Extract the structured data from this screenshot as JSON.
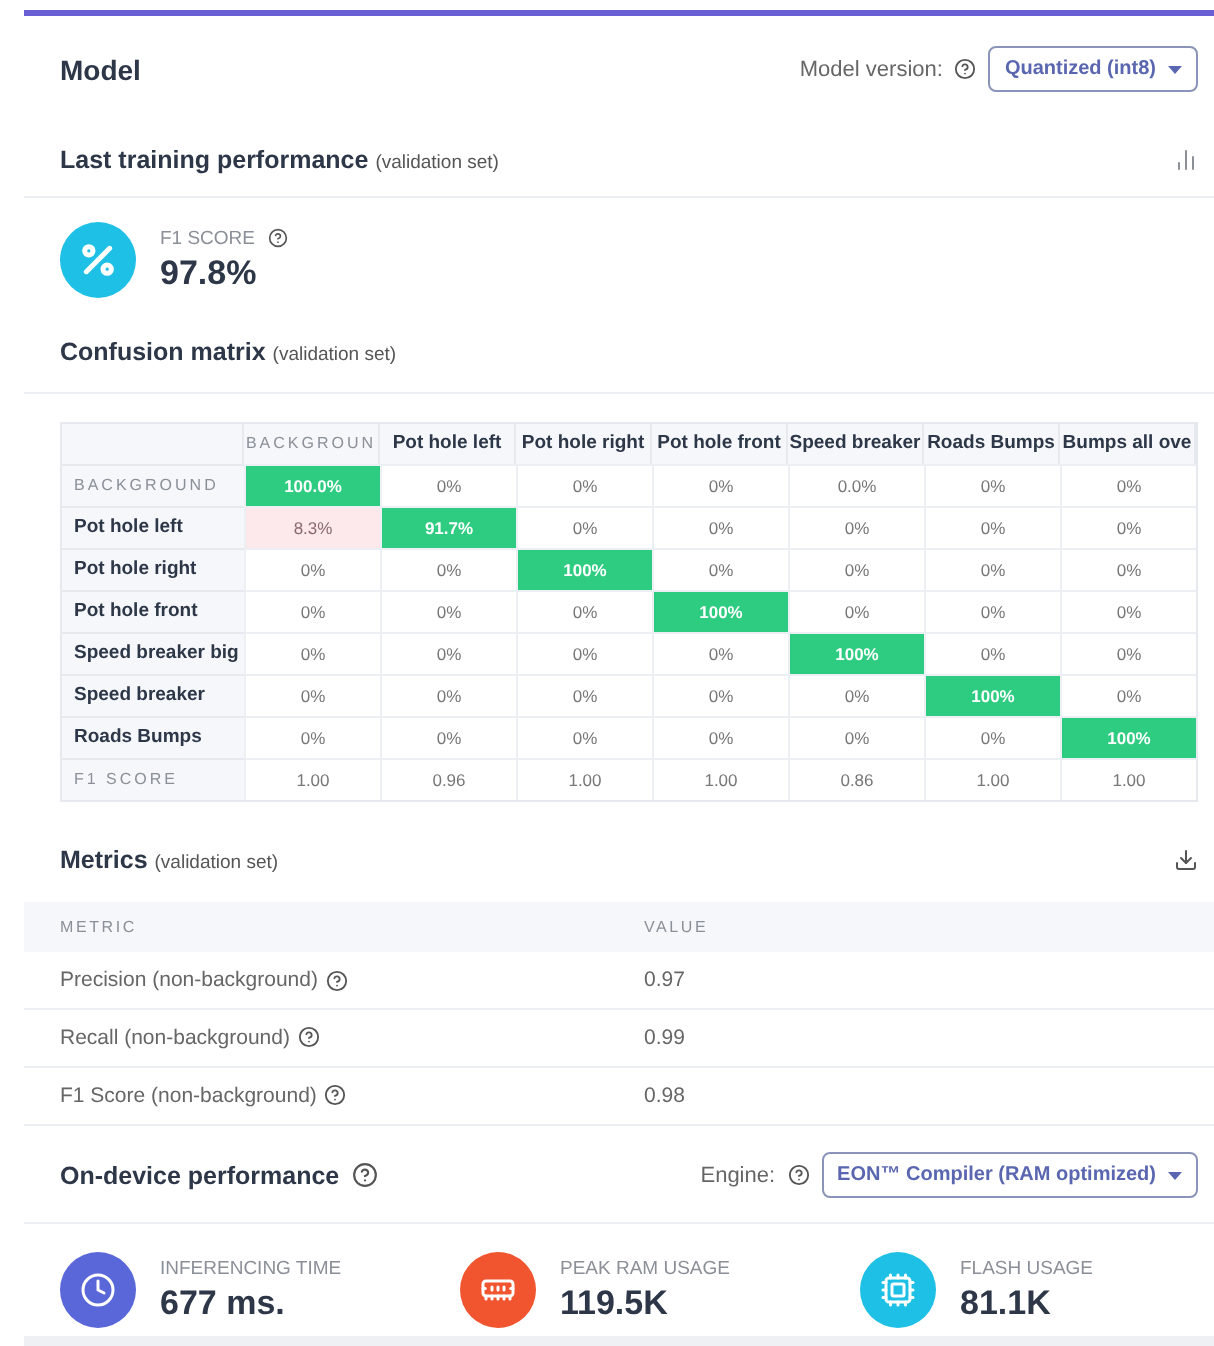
{
  "model": {
    "title": "Model",
    "version_label": "Model version:",
    "version_value": "Quantized (int8)"
  },
  "training": {
    "title": "Last training performance",
    "subtitle": "(validation set)",
    "score_label": "F1 SCORE",
    "score_value": "97.8%"
  },
  "matrix": {
    "title": "Confusion matrix",
    "subtitle": "(validation set)",
    "columns": [
      {
        "label": "BACKGROUN",
        "kind": "meta"
      },
      {
        "label": "Pot hole left",
        "kind": "class"
      },
      {
        "label": "Pot hole right",
        "kind": "class"
      },
      {
        "label": "Pot hole front",
        "kind": "class"
      },
      {
        "label": "Speed breaker",
        "kind": "class"
      },
      {
        "label": "Roads Bumps",
        "kind": "class"
      },
      {
        "label": "Bumps all ove",
        "kind": "class"
      }
    ],
    "rows": [
      {
        "label": "BACKGROUND",
        "kind": "meta",
        "cells": [
          {
            "text": "100.0%",
            "kind": "hit"
          },
          {
            "text": "0%",
            "kind": "plain"
          },
          {
            "text": "0%",
            "kind": "plain"
          },
          {
            "text": "0%",
            "kind": "plain"
          },
          {
            "text": "0.0%",
            "kind": "plain"
          },
          {
            "text": "0%",
            "kind": "plain"
          },
          {
            "text": "0%",
            "kind": "plain"
          }
        ]
      },
      {
        "label": "Pot hole left",
        "kind": "class",
        "cells": [
          {
            "text": "8.3%",
            "kind": "miss"
          },
          {
            "text": "91.7%",
            "kind": "hit"
          },
          {
            "text": "0%",
            "kind": "plain"
          },
          {
            "text": "0%",
            "kind": "plain"
          },
          {
            "text": "0%",
            "kind": "plain"
          },
          {
            "text": "0%",
            "kind": "plain"
          },
          {
            "text": "0%",
            "kind": "plain"
          }
        ]
      },
      {
        "label": "Pot hole right",
        "kind": "class",
        "cells": [
          {
            "text": "0%",
            "kind": "plain"
          },
          {
            "text": "0%",
            "kind": "plain"
          },
          {
            "text": "100%",
            "kind": "hit"
          },
          {
            "text": "0%",
            "kind": "plain"
          },
          {
            "text": "0%",
            "kind": "plain"
          },
          {
            "text": "0%",
            "kind": "plain"
          },
          {
            "text": "0%",
            "kind": "plain"
          }
        ]
      },
      {
        "label": "Pot hole front",
        "kind": "class",
        "cells": [
          {
            "text": "0%",
            "kind": "plain"
          },
          {
            "text": "0%",
            "kind": "plain"
          },
          {
            "text": "0%",
            "kind": "plain"
          },
          {
            "text": "100%",
            "kind": "hit"
          },
          {
            "text": "0%",
            "kind": "plain"
          },
          {
            "text": "0%",
            "kind": "plain"
          },
          {
            "text": "0%",
            "kind": "plain"
          }
        ]
      },
      {
        "label": "Speed breaker big",
        "kind": "class",
        "cells": [
          {
            "text": "0%",
            "kind": "plain"
          },
          {
            "text": "0%",
            "kind": "plain"
          },
          {
            "text": "0%",
            "kind": "plain"
          },
          {
            "text": "0%",
            "kind": "plain"
          },
          {
            "text": "100%",
            "kind": "hit"
          },
          {
            "text": "0%",
            "kind": "plain"
          },
          {
            "text": "0%",
            "kind": "plain"
          }
        ]
      },
      {
        "label": "Speed breaker",
        "kind": "class",
        "cells": [
          {
            "text": "0%",
            "kind": "plain"
          },
          {
            "text": "0%",
            "kind": "plain"
          },
          {
            "text": "0%",
            "kind": "plain"
          },
          {
            "text": "0%",
            "kind": "plain"
          },
          {
            "text": "0%",
            "kind": "plain"
          },
          {
            "text": "100%",
            "kind": "hit"
          },
          {
            "text": "0%",
            "kind": "plain"
          }
        ]
      },
      {
        "label": "Roads Bumps",
        "kind": "class",
        "cells": [
          {
            "text": "0%",
            "kind": "plain"
          },
          {
            "text": "0%",
            "kind": "plain"
          },
          {
            "text": "0%",
            "kind": "plain"
          },
          {
            "text": "0%",
            "kind": "plain"
          },
          {
            "text": "0%",
            "kind": "plain"
          },
          {
            "text": "0%",
            "kind": "plain"
          },
          {
            "text": "100%",
            "kind": "hit"
          }
        ]
      },
      {
        "label": "F1 SCORE",
        "kind": "meta",
        "cells": [
          {
            "text": "1.00",
            "kind": "plain"
          },
          {
            "text": "0.96",
            "kind": "plain"
          },
          {
            "text": "1.00",
            "kind": "plain"
          },
          {
            "text": "1.00",
            "kind": "plain"
          },
          {
            "text": "0.86",
            "kind": "plain"
          },
          {
            "text": "1.00",
            "kind": "plain"
          },
          {
            "text": "1.00",
            "kind": "plain"
          }
        ]
      }
    ]
  },
  "metrics": {
    "title": "Metrics",
    "subtitle": "(validation set)",
    "columns": [
      "METRIC",
      "VALUE"
    ],
    "rows": [
      {
        "metric": "Precision (non-background)",
        "value": "0.97"
      },
      {
        "metric": "Recall (non-background)",
        "value": "0.99"
      },
      {
        "metric": "F1 Score (non-background)",
        "value": "0.98"
      }
    ]
  },
  "on_device": {
    "title": "On-device performance",
    "engine_label": "Engine:",
    "engine_value": "EON™ Compiler (RAM optimized)",
    "stats": [
      {
        "kind": "time",
        "label": "INFERENCING TIME",
        "value": "677 ms.",
        "color": "#5a67d8"
      },
      {
        "kind": "ram",
        "label": "PEAK RAM USAGE",
        "value": "119.5K",
        "color": "#f0552f"
      },
      {
        "kind": "flash",
        "label": "FLASH USAGE",
        "value": "81.1K",
        "color": "#1ec0e6"
      }
    ]
  }
}
